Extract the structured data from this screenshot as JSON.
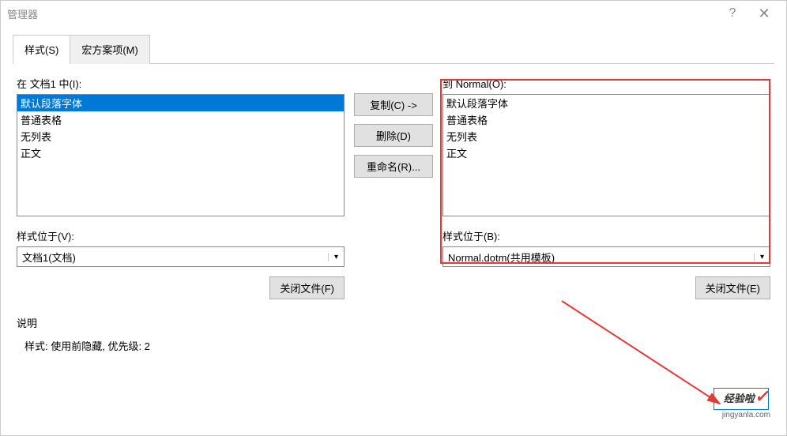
{
  "title": "管理器",
  "tabs": {
    "styles": "样式(S)",
    "macros": "宏方案项(M)"
  },
  "left": {
    "listLabel": "在 文档1 中(I):",
    "items": [
      "默认段落字体",
      "普通表格",
      "无列表",
      "正文"
    ],
    "locationLabel": "样式位于(V):",
    "locationValue": "文档1(文档)",
    "closeFile": "关闭文件(F)"
  },
  "mid": {
    "copy": "复制(C) ->",
    "delete": "删除(D)",
    "rename": "重命名(R)..."
  },
  "right": {
    "listLabel": "到 Normal(O):",
    "items": [
      "默认段落字体",
      "普通表格",
      "无列表",
      "正文"
    ],
    "locationLabel": "样式位于(B):",
    "locationValue": "Normal.dotm(共用模板)",
    "closeFile": "关闭文件(E)"
  },
  "desc": {
    "label": "说明",
    "text": "样式: 使用前隐藏, 优先级: 2"
  },
  "watermark": {
    "line1": "经验啦",
    "line2": "jingyanla.com"
  }
}
